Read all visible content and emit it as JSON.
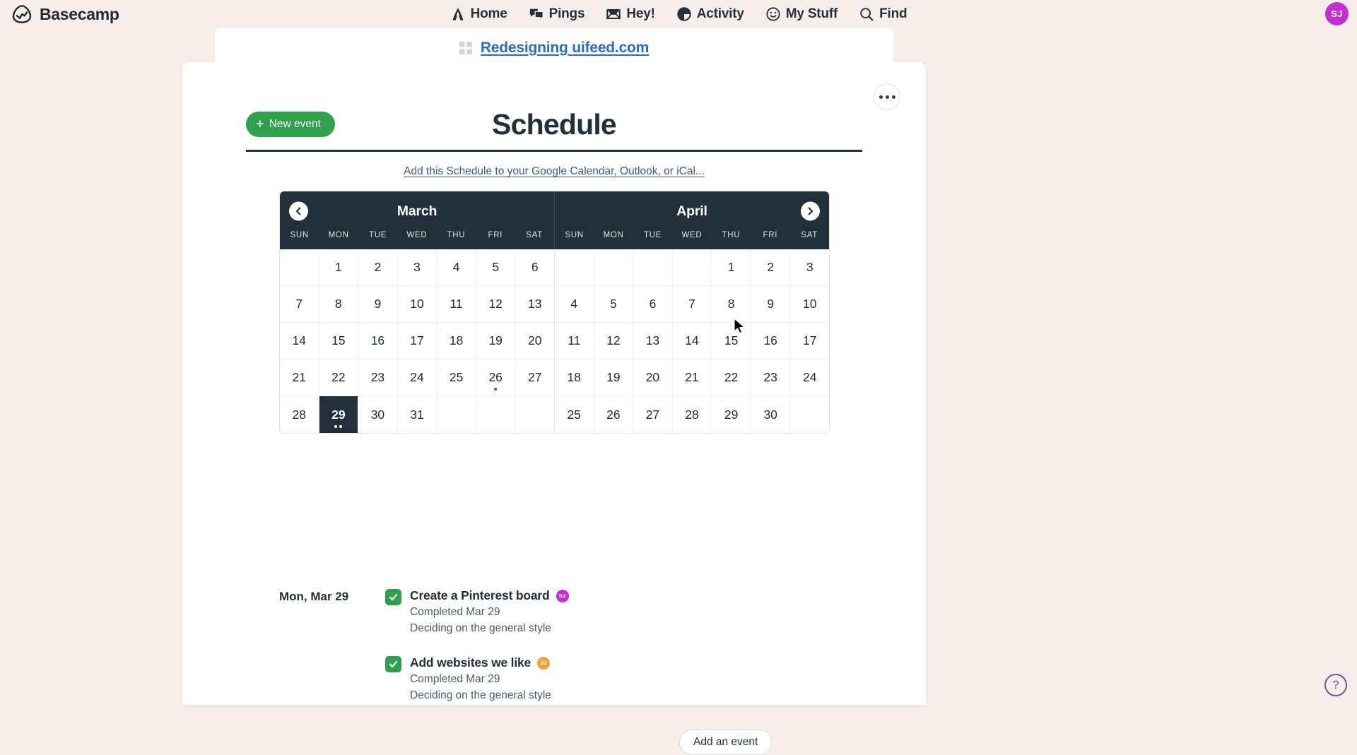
{
  "topbar": {
    "brand": "Basecamp",
    "nav": [
      {
        "label": "Home",
        "icon": "home-icon"
      },
      {
        "label": "Pings",
        "icon": "pings-icon"
      },
      {
        "label": "Hey!",
        "icon": "hey-inbox-icon"
      },
      {
        "label": "Activity",
        "icon": "activity-icon"
      },
      {
        "label": "My Stuff",
        "icon": "smiley-icon"
      },
      {
        "label": "Find",
        "icon": "search-icon"
      }
    ],
    "avatar": {
      "initials": "SJ",
      "color": "#C42FD0"
    }
  },
  "project": {
    "name": "Redesigning uifeed.com",
    "icon": "grid-icon",
    "link_color": "#2B6CC4"
  },
  "page": {
    "title": "Schedule",
    "new_event_label": "New event",
    "new_event_color": "#2FA14B",
    "calendar_subscribe_link": "Add this Schedule to your Google Calendar, Outlook, or iCal...",
    "overflow_menu": "more-options",
    "help_label": "?"
  },
  "calendar": {
    "header_color": "#22303A",
    "prev_label": "previous",
    "next_label": "next",
    "weekday_headers": [
      "SUN",
      "MON",
      "TUE",
      "WED",
      "THU",
      "FRI",
      "SAT"
    ],
    "months": [
      {
        "name": "March",
        "weeks": [
          [
            null,
            1,
            2,
            3,
            4,
            5,
            6
          ],
          [
            7,
            8,
            9,
            10,
            11,
            12,
            13
          ],
          [
            14,
            15,
            16,
            17,
            18,
            19,
            20
          ],
          [
            21,
            22,
            23,
            24,
            25,
            26,
            27
          ],
          [
            28,
            29,
            30,
            31,
            null,
            null,
            null
          ]
        ],
        "selected": 29,
        "event_dots": {
          "26": 1,
          "29": 2
        }
      },
      {
        "name": "April",
        "weeks": [
          [
            null,
            null,
            null,
            null,
            1,
            2,
            3
          ],
          [
            4,
            5,
            6,
            7,
            8,
            9,
            10
          ],
          [
            11,
            12,
            13,
            14,
            15,
            16,
            17
          ],
          [
            18,
            19,
            20,
            21,
            22,
            23,
            24
          ],
          [
            25,
            26,
            27,
            28,
            29,
            30,
            null
          ]
        ],
        "selected": null,
        "event_dots": {}
      }
    ]
  },
  "events": {
    "date_label": "Mon, Mar 29",
    "add_event_label": "Add an event",
    "items": [
      {
        "title": "Create a Pinterest board",
        "status": "Completed Mar 29",
        "note": "Deciding on the general style",
        "completed": true,
        "avatar": {
          "initials": "SJ",
          "color": "#C42FD0"
        }
      },
      {
        "title": "Add websites we like",
        "status": "Completed Mar 29",
        "note": "Deciding on the general style",
        "completed": true,
        "avatar": {
          "initials": "JJ",
          "color": "#F0A33C"
        }
      }
    ]
  }
}
